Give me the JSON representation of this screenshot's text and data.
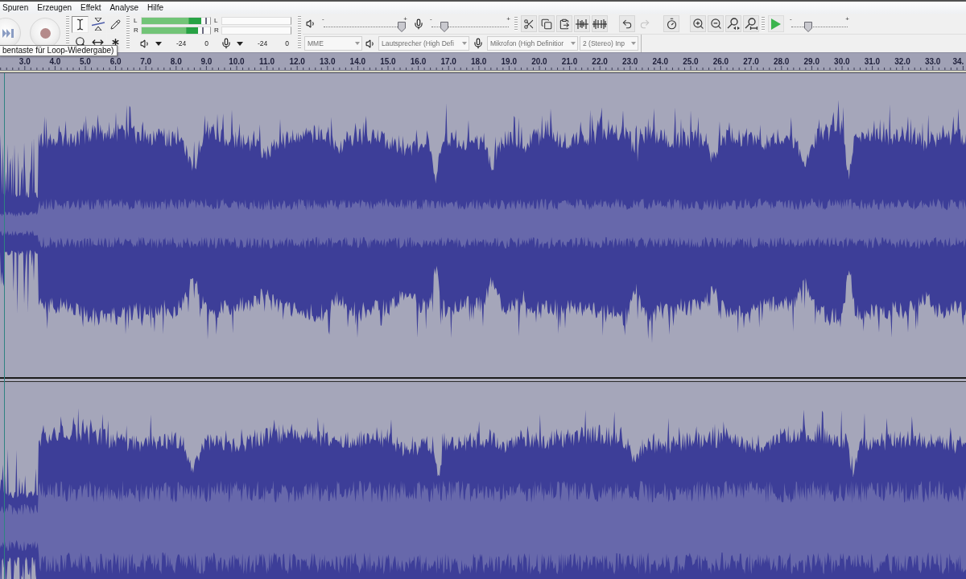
{
  "menu": [
    "Spuren",
    "Erzeugen",
    "Effekt",
    "Analyse",
    "Hilfe"
  ],
  "transport": [
    {
      "kind": "skip_end"
    },
    {
      "kind": "record"
    }
  ],
  "tools": [
    {
      "kind": "selection",
      "selected": true
    },
    {
      "kind": "envelope",
      "selected": false
    },
    {
      "kind": "draw",
      "selected": false
    },
    {
      "kind": "zoom",
      "selected": false
    },
    {
      "kind": "time_shift",
      "selected": false
    },
    {
      "kind": "multi",
      "selected": false
    }
  ],
  "meters": [
    {
      "kind": "playback",
      "channels": [
        {
          "label": "L",
          "level": 0.87
        },
        {
          "label": "R",
          "level": 0.82
        }
      ],
      "scale": [
        "-24",
        "0"
      ]
    },
    {
      "kind": "recording",
      "channels": [
        {
          "label": "L"
        },
        {
          "label": "R"
        }
      ],
      "scale": [
        "-24",
        "0"
      ]
    }
  ],
  "mixer": [
    {
      "kind": "output",
      "min_mark": "-",
      "max_mark": "+",
      "level": 0.95
    },
    {
      "kind": "input",
      "min_mark": "-",
      "max_mark": "+",
      "level": 0.17
    }
  ],
  "edit_groups": [
    {
      "buttons": [
        {
          "kind": "cut"
        },
        {
          "kind": "copy"
        },
        {
          "kind": "paste"
        },
        {
          "kind": "trim"
        },
        {
          "kind": "silence"
        }
      ]
    },
    {
      "buttons": [
        {
          "kind": "undo",
          "disabled": false
        },
        {
          "kind": "redo",
          "disabled": true
        }
      ]
    },
    {
      "buttons": [
        {
          "kind": "sync_lock"
        }
      ]
    },
    {
      "buttons": [
        {
          "kind": "zoom_in"
        },
        {
          "kind": "zoom_out"
        },
        {
          "kind": "fit_selection"
        },
        {
          "kind": "fit_project"
        }
      ]
    }
  ],
  "play_at_speed": {
    "min_mark": "-",
    "max_mark": "+",
    "level": 0.3
  },
  "devices": [
    {
      "kind": "host",
      "value": "MME"
    },
    {
      "kind": "output",
      "value": "Lautsprecher (High Defi"
    },
    {
      "kind": "input",
      "value": "Mikrofon (High Definitior"
    },
    {
      "kind": "channels",
      "value": "2 (Stereo) Inp"
    }
  ],
  "tooltip": "bentaste für Loop-Wiedergabe)",
  "ruler": {
    "labels": [
      "3.0",
      "4.0",
      "5.0",
      "6.0",
      "7.0",
      "8.0",
      "9.0",
      "10.0",
      "11.0",
      "12.0",
      "13.0",
      "14.0",
      "15.0",
      "16.0",
      "17.0",
      "18.0",
      "19.0",
      "20.0",
      "21.0",
      "22.0",
      "23.0",
      "24.0",
      "25.0",
      "26.0",
      "27.0",
      "28.0",
      "29.0",
      "30.0",
      "31.0",
      "32.0",
      "33.0",
      "34."
    ]
  },
  "tracks": [
    {
      "kind": "waveform"
    },
    {
      "kind": "waveform"
    }
  ]
}
